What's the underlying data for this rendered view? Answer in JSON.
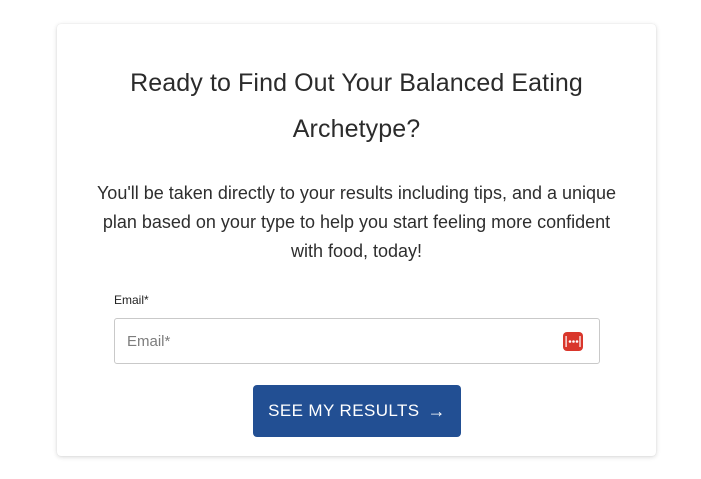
{
  "form": {
    "title": "Ready to Find Out Your Balanced Eating Archetype?",
    "description": "You'll be taken directly to your results including tips, and a unique plan based on your type to help you start feeling more confident with food, today!",
    "email_label": "Email*",
    "email_placeholder": "Email*",
    "email_value": "",
    "submit_label": "SEE MY RESULTS",
    "submit_arrow": "→"
  },
  "icons": {
    "password_manager": "password-manager-icon"
  },
  "colors": {
    "button_bg": "#224f93",
    "button_text": "#ffffff",
    "password_icon": "#d9362b",
    "text": "#2b2b2b"
  }
}
